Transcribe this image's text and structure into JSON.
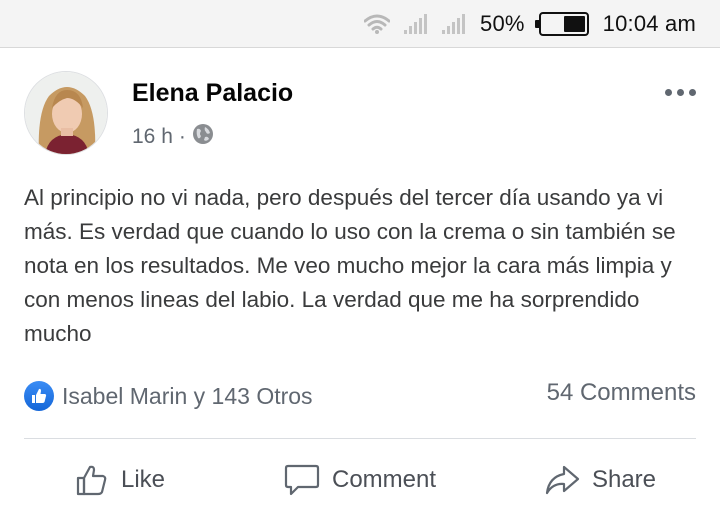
{
  "status_bar": {
    "battery_percent": "50%",
    "battery_level": 0.5,
    "time": "10:04 am",
    "icons": [
      "wifi-icon",
      "signal-icon",
      "signal-icon",
      "battery-icon"
    ]
  },
  "post": {
    "author_name": "Elena Palacio",
    "timestamp": "16 h",
    "separator": "·",
    "privacy_icon": "globe-icon",
    "body_text": "Al principio no vi nada, pero después del tercer día usando ya vi más. Es verdad que cuando lo uso con la crema o sin también se nota en los resultados. Me veo mucho mejor la cara más limpia y con menos lineas del labio. La verdad que me ha sorprendido mucho",
    "reactions_text": "Isabel Marin y 143 Otros",
    "comments_text": "54 Comments"
  },
  "actions": {
    "like_label": "Like",
    "comment_label": "Comment",
    "share_label": "Share"
  },
  "colors": {
    "like_blue": "#1877f2",
    "meta_gray": "#606770",
    "divider": "#dadde1"
  }
}
